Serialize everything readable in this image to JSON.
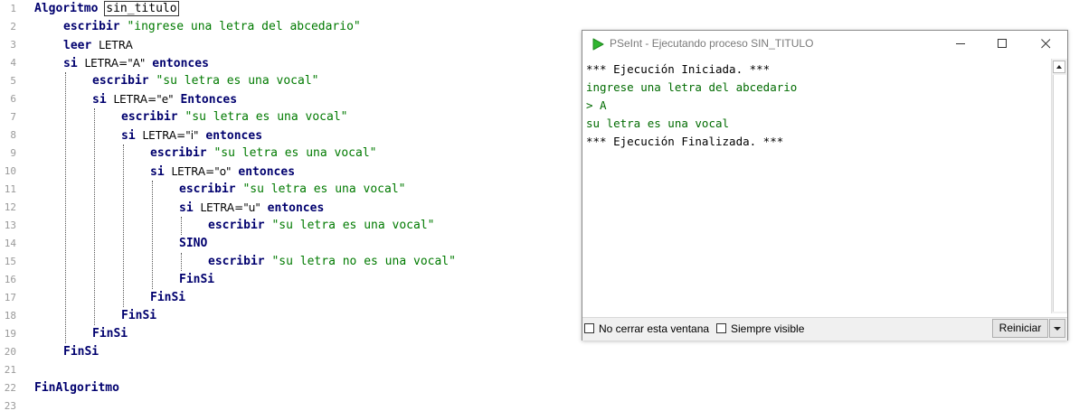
{
  "editor": {
    "line_numbers": [
      "1",
      "2",
      "3",
      "4",
      "5",
      "6",
      "7",
      "8",
      "9",
      "10",
      "11",
      "12",
      "13",
      "14",
      "15",
      "16",
      "17",
      "18",
      "19",
      "20",
      "21",
      "22",
      "23"
    ],
    "tokens": {
      "algoritmo": "Algoritmo",
      "algo_name": "sin_titulo",
      "escribir": "escribir",
      "leer": "leer",
      "si": "si",
      "entonces": "entonces",
      "entonces_cap": "Entonces",
      "sino": "SINO",
      "finsi": "FinSi",
      "finalgoritmo": "FinAlgoritmo",
      "var_letra": "LETRA",
      "cond_a": "LETRA=\"A\"",
      "cond_e": "LETRA=\"e\"",
      "cond_i": "LETRA=\"i\"",
      "cond_o": "LETRA=\"o\"",
      "cond_u": "LETRA=\"u\"",
      "str_prompt": "\"ingrese una letra del abcedario\"",
      "str_vocal": "\"su letra es una vocal\"",
      "str_no_vocal": "\"su letra no es una vocal\""
    }
  },
  "console": {
    "title": "PSeInt - Ejecutando proceso SIN_TITULO",
    "output_lines": [
      "*** Ejecución Iniciada. ***",
      "ingrese una letra del abcedario",
      "> A",
      "su letra es una vocal",
      "*** Ejecución Finalizada. ***"
    ],
    "checkbox_no_cerrar": "No cerrar esta ventana",
    "checkbox_siempre_visible": "Siempre visible",
    "restart_button": "Reiniciar",
    "colors": {
      "keyword": "#00006e",
      "string": "#007a00",
      "app_icon": "#2fb52f"
    },
    "icons": [
      "pseint-play-icon",
      "minimize-icon",
      "maximize-icon",
      "close-icon",
      "scroll-up-arrow-icon",
      "dropdown-arrow-icon"
    ]
  }
}
